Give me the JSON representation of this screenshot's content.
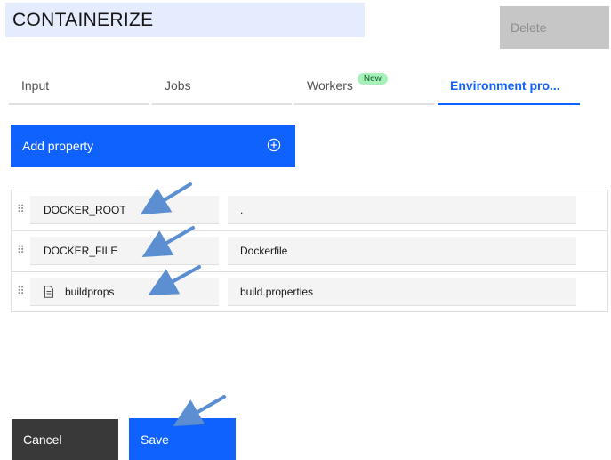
{
  "header": {
    "title": "CONTAINERIZE",
    "delete_label": "Delete"
  },
  "tabs": [
    {
      "label": "Input",
      "active": false
    },
    {
      "label": "Jobs",
      "active": false
    },
    {
      "label": "Workers",
      "badge": "New",
      "active": false
    },
    {
      "label": "Environment pro...",
      "active": true
    }
  ],
  "add_property": {
    "label": "Add property",
    "icon": "add-circle-icon"
  },
  "properties": [
    {
      "key": "DOCKER_ROOT",
      "value": ".",
      "icon": null
    },
    {
      "key": "DOCKER_FILE",
      "value": "Dockerfile",
      "icon": null
    },
    {
      "key": "buildprops",
      "value": "build.properties",
      "icon": "document-icon"
    }
  ],
  "footer": {
    "cancel_label": "Cancel",
    "save_label": "Save"
  },
  "colors": {
    "primary": "#0f62fe",
    "title_bg": "#e5ecfe",
    "badge_bg": "#a7f0ba",
    "arrow": "#5b8fd1"
  }
}
